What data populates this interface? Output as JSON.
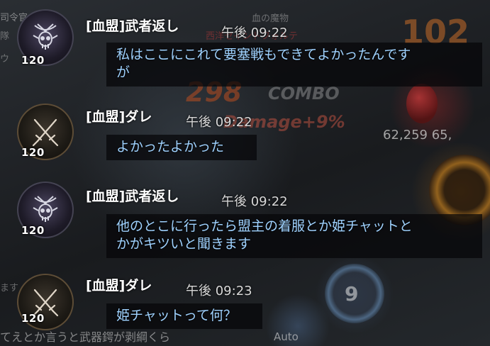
{
  "background": {
    "top_name": "血の魔物",
    "top_name2": "西洋セイントフォルテ",
    "command_text": "司令官",
    "side_text_1": "隊",
    "side_text_2": "ウ",
    "side_text_3": "ます",
    "big_number": "102",
    "combo_number": "298",
    "combo_label": "COMBO",
    "damage_text": "Damage+9%",
    "hp_text": "62,259 65,",
    "skill_number": "9",
    "auto_label": "Auto",
    "bottom_line": "てえとか言うと武器鍔が剥綱くら"
  },
  "messages": [
    {
      "level": "120",
      "avatar_icon": "skull-crest-icon",
      "name": "[血盟]武者返し",
      "time": "午後 09:22",
      "text": "私はここにこれて要塞戦もできてよかったんです\nが"
    },
    {
      "level": "120",
      "avatar_icon": "crossed-swords-icon",
      "name": "[血盟]ダレ",
      "time": "午後 09:22",
      "text": "よかったよかった"
    },
    {
      "level": "120",
      "avatar_icon": "skull-crest-icon",
      "name": "[血盟]武者返し",
      "time": "午後 09:22",
      "text": "他のとこに行ったら盟主の着服とか姫チャットと\nかがキツいと聞きます"
    },
    {
      "level": "120",
      "avatar_icon": "crossed-swords-icon",
      "name": "[血盟]ダレ",
      "time": "午後 09:23",
      "text": "姫チャットって何？"
    }
  ],
  "colors": {
    "message_text": "#9fd2ff",
    "name_text": "#ffffff",
    "time_text": "#d8d8d8"
  }
}
